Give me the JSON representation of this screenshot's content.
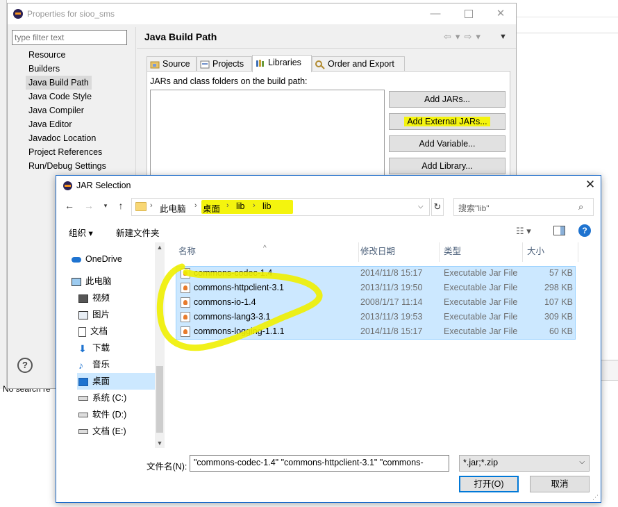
{
  "properties": {
    "title": "Properties for sioo_sms",
    "filter_placeholder": "type filter text",
    "nav_items": [
      "Resource",
      "Builders",
      "Java Build Path",
      "Java Code Style",
      "Java Compiler",
      "Java Editor",
      "Javadoc Location",
      "Project References",
      "Run/Debug Settings"
    ],
    "selected_nav": "Java Build Path",
    "page_title": "Java Build Path",
    "tabs": [
      "Source",
      "Projects",
      "Libraries",
      "Order and Export"
    ],
    "active_tab": "Libraries",
    "jars_label": "JARs and class folders on the build path:",
    "buttons": [
      "Add JARs...",
      "Add External JARs...",
      "Add Variable...",
      "Add Library..."
    ],
    "help_glyph": "?",
    "status_text": "No search re"
  },
  "dialog": {
    "title": "JAR Selection",
    "breadcrumb": [
      "此电脑",
      "桌面",
      "lib",
      "lib"
    ],
    "search_placeholder": "搜索\"lib\"",
    "toolbar": {
      "organize": "组织 ▾",
      "new_folder": "新建文件夹"
    },
    "nav_pane": [
      {
        "label": "OneDrive",
        "icon": "cloud-icon"
      },
      {
        "label": "此电脑",
        "icon": "computer-icon"
      },
      {
        "label": "视频",
        "icon": "video-icon"
      },
      {
        "label": "图片",
        "icon": "picture-icon"
      },
      {
        "label": "文档",
        "icon": "document-icon"
      },
      {
        "label": "下载",
        "icon": "download-icon"
      },
      {
        "label": "音乐",
        "icon": "music-icon"
      },
      {
        "label": "桌面",
        "icon": "desktop-icon"
      },
      {
        "label": "系统 (C:)",
        "icon": "drive-icon"
      },
      {
        "label": "软件 (D:)",
        "icon": "drive-icon"
      },
      {
        "label": "文档 (E:)",
        "icon": "drive-icon"
      }
    ],
    "selected_nav": "桌面",
    "columns": [
      "名称",
      "修改日期",
      "类型",
      "大小"
    ],
    "files": [
      {
        "name": "commons-codec-1.4",
        "date": "2014/11/8 15:17",
        "type": "Executable Jar File",
        "size": "57 KB"
      },
      {
        "name": "commons-httpclient-3.1",
        "date": "2013/11/3 19:50",
        "type": "Executable Jar File",
        "size": "298 KB"
      },
      {
        "name": "commons-io-1.4",
        "date": "2008/1/17 11:14",
        "type": "Executable Jar File",
        "size": "107 KB"
      },
      {
        "name": "commons-lang3-3.1",
        "date": "2013/11/3 19:53",
        "type": "Executable Jar File",
        "size": "309 KB"
      },
      {
        "name": "commons-logging-1.1.1",
        "date": "2014/11/8 15:17",
        "type": "Executable Jar File",
        "size": "60 KB"
      }
    ],
    "file_name_label": "文件名(N):",
    "file_name_value": "\"commons-codec-1.4\" \"commons-httpclient-3.1\" \"commons-",
    "filter_value": "*.jar;*.zip",
    "open_label": "打开(O)",
    "cancel_label": "取消"
  },
  "colors": {
    "highlight": "#f4f40e",
    "selection": "#cce8ff",
    "accent": "#0078d7"
  }
}
